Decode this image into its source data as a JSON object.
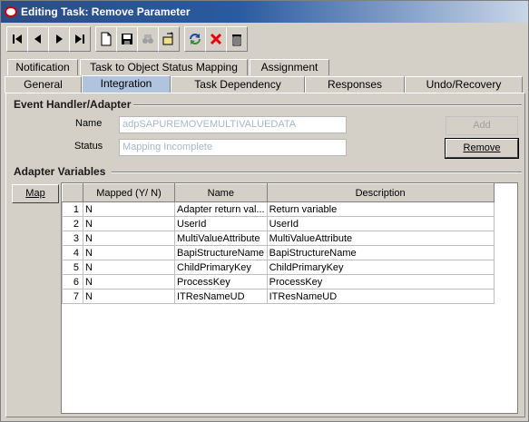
{
  "window": {
    "title": "Editing Task: Remove Parameter"
  },
  "toolbar": {
    "buttons": [
      {
        "name": "first-record-icon"
      },
      {
        "name": "previous-record-icon"
      },
      {
        "name": "next-record-icon"
      },
      {
        "name": "last-record-icon"
      },
      {
        "name": "new-icon"
      },
      {
        "name": "save-icon"
      },
      {
        "name": "find-icon"
      },
      {
        "name": "edit-icon"
      },
      {
        "name": "refresh-icon"
      },
      {
        "name": "delete-icon"
      },
      {
        "name": "trash-icon"
      }
    ]
  },
  "tabs_row1": [
    "Notification",
    "Task to Object Status Mapping",
    "Assignment"
  ],
  "tabs_row2": [
    "General",
    "Integration",
    "Task Dependency",
    "Responses",
    "Undo/Recovery"
  ],
  "active_tab": "Integration",
  "event_handler": {
    "section_title": "Event Handler/Adapter",
    "name_label": "Name",
    "name_value": "adpSAPUREMOVEMULTIVALUEDATA",
    "status_label": "Status",
    "status_value": "Mapping Incomplete",
    "add_label": "Add",
    "remove_label": "Remove"
  },
  "adapter_variables": {
    "section_title": "Adapter Variables",
    "map_label": "Map",
    "columns": [
      "",
      "Mapped (Y/ N)",
      "Name",
      "Description"
    ],
    "rows": [
      {
        "num": "1",
        "mapped": "N",
        "name": "Adapter return val...",
        "desc": "Return variable"
      },
      {
        "num": "2",
        "mapped": "N",
        "name": "UserId",
        "desc": "UserId"
      },
      {
        "num": "3",
        "mapped": "N",
        "name": "MultiValueAttribute",
        "desc": "MultiValueAttribute"
      },
      {
        "num": "4",
        "mapped": "N",
        "name": "BapiStructureName",
        "desc": "BapiStructureName"
      },
      {
        "num": "5",
        "mapped": "N",
        "name": "ChildPrimaryKey",
        "desc": "ChildPrimaryKey"
      },
      {
        "num": "6",
        "mapped": "N",
        "name": "ProcessKey",
        "desc": "ProcessKey"
      },
      {
        "num": "7",
        "mapped": "N",
        "name": "ITResNameUD",
        "desc": "ITResNameUD"
      }
    ]
  }
}
